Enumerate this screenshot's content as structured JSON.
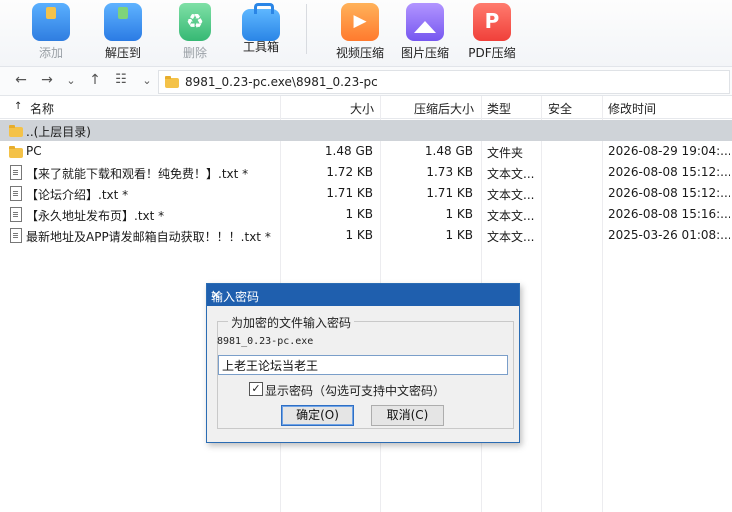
{
  "toolbar": {
    "items": [
      {
        "label": "添加",
        "icon": "add-archive-icon",
        "disabled": true
      },
      {
        "label": "解压到",
        "icon": "extract-icon",
        "disabled": false
      },
      {
        "label": "删除",
        "icon": "recycle-delete-icon",
        "disabled": true
      },
      {
        "label": "工具箱",
        "icon": "toolbox-icon",
        "disabled": false
      },
      {
        "label": "视频压缩",
        "icon": "video-compress-icon",
        "disabled": false
      },
      {
        "label": "图片压缩",
        "icon": "image-compress-icon",
        "disabled": false
      },
      {
        "label": "PDF压缩",
        "icon": "pdf-compress-icon",
        "disabled": false
      }
    ]
  },
  "address": {
    "path": "8981_0.23-pc.exe\\8981_0.23-pc"
  },
  "columns": {
    "name": "名称",
    "size": "大小",
    "packed": "压缩后大小",
    "type": "类型",
    "security": "安全",
    "modified": "修改时间"
  },
  "rows": [
    {
      "name": "..(上层目录)",
      "size": "",
      "packed": "",
      "type": "",
      "modified": ""
    },
    {
      "name": "PC",
      "size": "1.48 GB",
      "packed": "1.48 GB",
      "type": "文件夹",
      "modified": "2026-08-29 19:04:..."
    },
    {
      "name": "【来了就能下载和观看！纯免费！】.txt *",
      "size": "1.72 KB",
      "packed": "1.73 KB",
      "type": "文本文...",
      "modified": "2026-08-08 15:12:..."
    },
    {
      "name": "【论坛介绍】.txt *",
      "size": "1.71 KB",
      "packed": "1.71 KB",
      "type": "文本文...",
      "modified": "2026-08-08 15:12:..."
    },
    {
      "name": "【永久地址发布页】.txt *",
      "size": "1 KB",
      "packed": "1 KB",
      "type": "文本文...",
      "modified": "2026-08-08 15:16:..."
    },
    {
      "name": "最新地址及APP请发邮箱自动获取！！！.txt *",
      "size": "1 KB",
      "packed": "1 KB",
      "type": "文本文...",
      "modified": "2025-03-26 01:08:..."
    }
  ],
  "dialog": {
    "title": "输入密码",
    "close": "✕",
    "group_label": "为加密的文件输入密码",
    "filename": "8981_0.23-pc.exe",
    "password_value": "上老王论坛当老王",
    "show_password_checked": true,
    "checkbox_mark": "✓",
    "show_password_label": "显示密码（勾选可支持中文密码）",
    "ok_label": "确定(O)",
    "cancel_label": "取消(C)"
  },
  "colors": {
    "dialog_title_bg": "#1f5fae",
    "selected_row_bg": "#cfd3d8",
    "folder": "#f4c248"
  }
}
